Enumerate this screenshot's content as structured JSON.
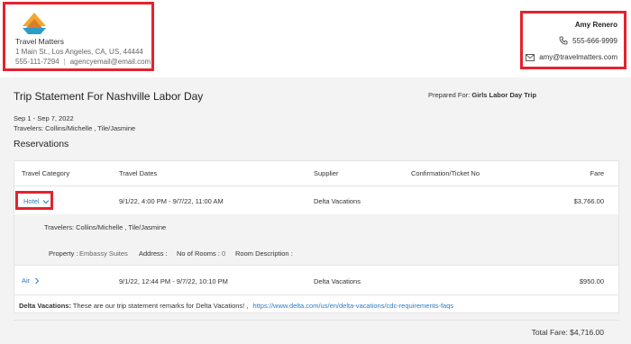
{
  "agency": {
    "name": "Travel Matters",
    "address": "1 Main St., Los Angeles, CA, US, 44444",
    "phone": "555-111-7294",
    "email": "agencyemail@email.com",
    "logo_icon": "mountain-logo-icon"
  },
  "agent": {
    "name": "Amy Renero",
    "phone": "555-666-9999",
    "email": "amy@travelmatters.com",
    "phone_icon": "phone-icon",
    "email_icon": "envelope-icon"
  },
  "trip": {
    "title": "Trip Statement For Nashville Labor Day",
    "prepared_label": "Prepared For:",
    "prepared_for": "Girls Labor Day Trip",
    "dates": "Sep 1 - Sep 7, 2022",
    "travelers": "Travelers: Collins/Michelle , Tile/Jasmine"
  },
  "reservations": {
    "title": "Reservations",
    "columns": [
      "Travel Category",
      "Travel Dates",
      "Supplier",
      "Confirmation/Ticket No",
      "Fare"
    ],
    "rows": [
      {
        "category": "Hotel",
        "dates": "9/1/22, 4:00 PM - 9/7/22, 11:00 AM",
        "supplier": "Delta Vacations",
        "confirmation": "",
        "fare": "$3,766.00",
        "expanded": true,
        "details": {
          "travelers": "Travelers: Collins/Michelle , Tile/Jasmine",
          "property_label": "Property :",
          "property": "Embassy Suites",
          "address_label": "Address :",
          "rooms_label": "No of Rooms :",
          "rooms": "0",
          "room_desc_label": "Room Description :"
        }
      },
      {
        "category": "Air",
        "dates": "9/1/22, 12:44 PM - 9/7/22, 10:10 PM",
        "supplier": "Delta Vacations",
        "confirmation": "",
        "fare": "$950.00",
        "expanded": false
      }
    ]
  },
  "remarks": {
    "supplier": "Delta Vacations:",
    "text": "These are our trip statement remarks for Delta Vacations! ,",
    "link": "https://www.delta.com/us/en/delta-vacations/cdc-requirements-faqs"
  },
  "total": "Total Fare: $4,716.00",
  "colors": {
    "highlight": "#e3232f",
    "link": "#2b7bc9",
    "background": "#f3f3f4"
  }
}
